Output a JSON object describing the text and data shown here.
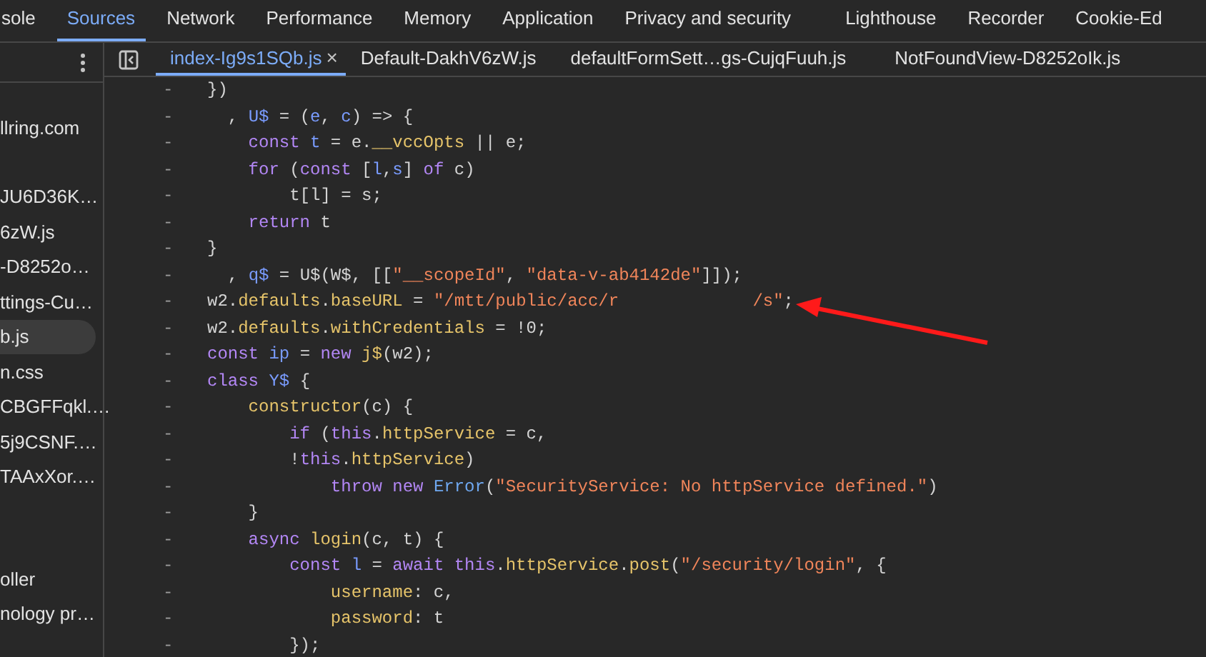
{
  "panel_tabs": [
    {
      "label": "sole",
      "selected": false
    },
    {
      "label": "Sources",
      "selected": true
    },
    {
      "label": "Network",
      "selected": false
    },
    {
      "label": "Performance",
      "selected": false
    },
    {
      "label": "Memory",
      "selected": false
    },
    {
      "label": "Application",
      "selected": false
    },
    {
      "label": "Privacy and security",
      "selected": false
    },
    {
      "label": "Lighthouse",
      "selected": false
    },
    {
      "label": "Recorder",
      "selected": false
    },
    {
      "label": "Cookie-Ed",
      "selected": false
    }
  ],
  "editor_tabs": [
    {
      "label": "index-Ig9s1SQb.js",
      "selected": true,
      "close": "×"
    },
    {
      "label": "Default-DakhV6zW.js",
      "selected": false
    },
    {
      "label": "defaultFormSett…gs-CujqFuuh.js",
      "selected": false
    },
    {
      "label": "NotFoundView-D8252oIk.js",
      "selected": false
    }
  ],
  "sidebar": {
    "items": [
      {
        "label": "llring.com",
        "selected": false
      },
      {
        "label": "JU6D36K…",
        "selected": false
      },
      {
        "label": "6zW.js",
        "selected": false
      },
      {
        "label": "-D8252o…",
        "selected": false
      },
      {
        "label": "ttings-Cu…",
        "selected": false
      },
      {
        "label": "b.js",
        "selected": true
      },
      {
        "label": "n.css",
        "selected": false
      },
      {
        "label": "CBGFFqkl.…",
        "selected": false
      },
      {
        "label": "5j9CSNF.…",
        "selected": false
      },
      {
        "label": "TAAxXor.…",
        "selected": false
      },
      {
        "label": "oller",
        "selected": false
      },
      {
        "label": "nology pr…",
        "selected": false
      }
    ]
  },
  "code": {
    "lines": [
      {
        "gutter": "-",
        "tokens": [
          {
            "kind": "punc",
            "text": "})"
          }
        ]
      },
      {
        "gutter": "-",
        "tokens": [
          {
            "kind": "punc",
            "text": "  , "
          },
          {
            "kind": "var",
            "text": "U$"
          },
          {
            "kind": "punc",
            "text": " = ("
          },
          {
            "kind": "var",
            "text": "e"
          },
          {
            "kind": "punc",
            "text": ", "
          },
          {
            "kind": "var",
            "text": "c"
          },
          {
            "kind": "punc",
            "text": ") => {"
          }
        ]
      },
      {
        "gutter": "-",
        "tokens": [
          {
            "kind": "keyword",
            "text": "    const "
          },
          {
            "kind": "var",
            "text": "t"
          },
          {
            "kind": "punc",
            "text": " = e."
          },
          {
            "kind": "prop",
            "text": "__vccOpts"
          },
          {
            "kind": "punc",
            "text": " || e;"
          }
        ]
      },
      {
        "gutter": "-",
        "tokens": [
          {
            "kind": "keyword",
            "text": "    for"
          },
          {
            "kind": "punc",
            "text": " ("
          },
          {
            "kind": "keyword",
            "text": "const"
          },
          {
            "kind": "punc",
            "text": " ["
          },
          {
            "kind": "var",
            "text": "l"
          },
          {
            "kind": "punc",
            "text": ","
          },
          {
            "kind": "var",
            "text": "s"
          },
          {
            "kind": "punc",
            "text": "] "
          },
          {
            "kind": "keyword",
            "text": "of"
          },
          {
            "kind": "punc",
            "text": " c)"
          }
        ]
      },
      {
        "gutter": "-",
        "tokens": [
          {
            "kind": "punc",
            "text": "        t[l] = s;"
          }
        ]
      },
      {
        "gutter": "-",
        "tokens": [
          {
            "kind": "keyword",
            "text": "    return"
          },
          {
            "kind": "punc",
            "text": " t"
          }
        ]
      },
      {
        "gutter": "-",
        "tokens": [
          {
            "kind": "punc",
            "text": "}"
          }
        ]
      },
      {
        "gutter": "-",
        "tokens": [
          {
            "kind": "punc",
            "text": "  , "
          },
          {
            "kind": "var",
            "text": "q$"
          },
          {
            "kind": "punc",
            "text": " = U$(W$, [["
          },
          {
            "kind": "string",
            "text": "\"__scopeId\""
          },
          {
            "kind": "punc",
            "text": ", "
          },
          {
            "kind": "string",
            "text": "\"data-v-ab4142de\""
          },
          {
            "kind": "punc",
            "text": "]]);"
          }
        ]
      },
      {
        "gutter": "-",
        "tokens": [
          {
            "kind": "punc",
            "text": "w2."
          },
          {
            "kind": "prop",
            "text": "defaults"
          },
          {
            "kind": "punc",
            "text": "."
          },
          {
            "kind": "prop",
            "text": "baseURL"
          },
          {
            "kind": "punc",
            "text": " = "
          },
          {
            "kind": "string",
            "text": "\"/mtt/public/acc/r             /s\""
          },
          {
            "kind": "punc",
            "text": ";"
          }
        ]
      },
      {
        "gutter": "-",
        "tokens": [
          {
            "kind": "punc",
            "text": "w2."
          },
          {
            "kind": "prop",
            "text": "defaults"
          },
          {
            "kind": "punc",
            "text": "."
          },
          {
            "kind": "prop",
            "text": "withCredentials"
          },
          {
            "kind": "punc",
            "text": " = !0;"
          }
        ]
      },
      {
        "gutter": "-",
        "tokens": [
          {
            "kind": "keyword",
            "text": "const "
          },
          {
            "kind": "var",
            "text": "ip"
          },
          {
            "kind": "punc",
            "text": " = "
          },
          {
            "kind": "keyword",
            "text": "new "
          },
          {
            "kind": "func",
            "text": "j$"
          },
          {
            "kind": "punc",
            "text": "(w2);"
          }
        ]
      },
      {
        "gutter": "-",
        "tokens": [
          {
            "kind": "keyword",
            "text": "class "
          },
          {
            "kind": "var",
            "text": "Y$"
          },
          {
            "kind": "punc",
            "text": " {"
          }
        ]
      },
      {
        "gutter": "-",
        "tokens": [
          {
            "kind": "func",
            "text": "    constructor"
          },
          {
            "kind": "punc",
            "text": "(c) {"
          }
        ]
      },
      {
        "gutter": "-",
        "tokens": [
          {
            "kind": "keyword",
            "text": "        if"
          },
          {
            "kind": "punc",
            "text": " ("
          },
          {
            "kind": "keyword",
            "text": "this"
          },
          {
            "kind": "punc",
            "text": "."
          },
          {
            "kind": "prop",
            "text": "httpService"
          },
          {
            "kind": "punc",
            "text": " = c,"
          }
        ]
      },
      {
        "gutter": "-",
        "tokens": [
          {
            "kind": "punc",
            "text": "        !"
          },
          {
            "kind": "keyword",
            "text": "this"
          },
          {
            "kind": "punc",
            "text": "."
          },
          {
            "kind": "prop",
            "text": "httpService"
          },
          {
            "kind": "punc",
            "text": ")"
          }
        ]
      },
      {
        "gutter": "-",
        "tokens": [
          {
            "kind": "keyword",
            "text": "            throw new "
          },
          {
            "kind": "class",
            "text": "Error"
          },
          {
            "kind": "punc",
            "text": "("
          },
          {
            "kind": "string",
            "text": "\"SecurityService: No httpService defined.\""
          },
          {
            "kind": "punc",
            "text": ")"
          }
        ]
      },
      {
        "gutter": "-",
        "tokens": [
          {
            "kind": "punc",
            "text": "    }"
          }
        ]
      },
      {
        "gutter": "-",
        "tokens": [
          {
            "kind": "keyword",
            "text": "    async "
          },
          {
            "kind": "func",
            "text": "login"
          },
          {
            "kind": "punc",
            "text": "(c, t) {"
          }
        ]
      },
      {
        "gutter": "-",
        "tokens": [
          {
            "kind": "keyword",
            "text": "        const "
          },
          {
            "kind": "var",
            "text": "l"
          },
          {
            "kind": "punc",
            "text": " = "
          },
          {
            "kind": "keyword",
            "text": "await this"
          },
          {
            "kind": "punc",
            "text": "."
          },
          {
            "kind": "prop",
            "text": "httpService"
          },
          {
            "kind": "punc",
            "text": "."
          },
          {
            "kind": "func",
            "text": "post"
          },
          {
            "kind": "punc",
            "text": "("
          },
          {
            "kind": "string",
            "text": "\"/security/login\""
          },
          {
            "kind": "punc",
            "text": ", {"
          }
        ]
      },
      {
        "gutter": "-",
        "tokens": [
          {
            "kind": "prop",
            "text": "            username"
          },
          {
            "kind": "punc",
            "text": ": c,"
          }
        ]
      },
      {
        "gutter": "-",
        "tokens": [
          {
            "kind": "prop",
            "text": "            password"
          },
          {
            "kind": "punc",
            "text": ": t"
          }
        ]
      },
      {
        "gutter": "-",
        "tokens": [
          {
            "kind": "punc",
            "text": "        });"
          }
        ]
      }
    ]
  }
}
